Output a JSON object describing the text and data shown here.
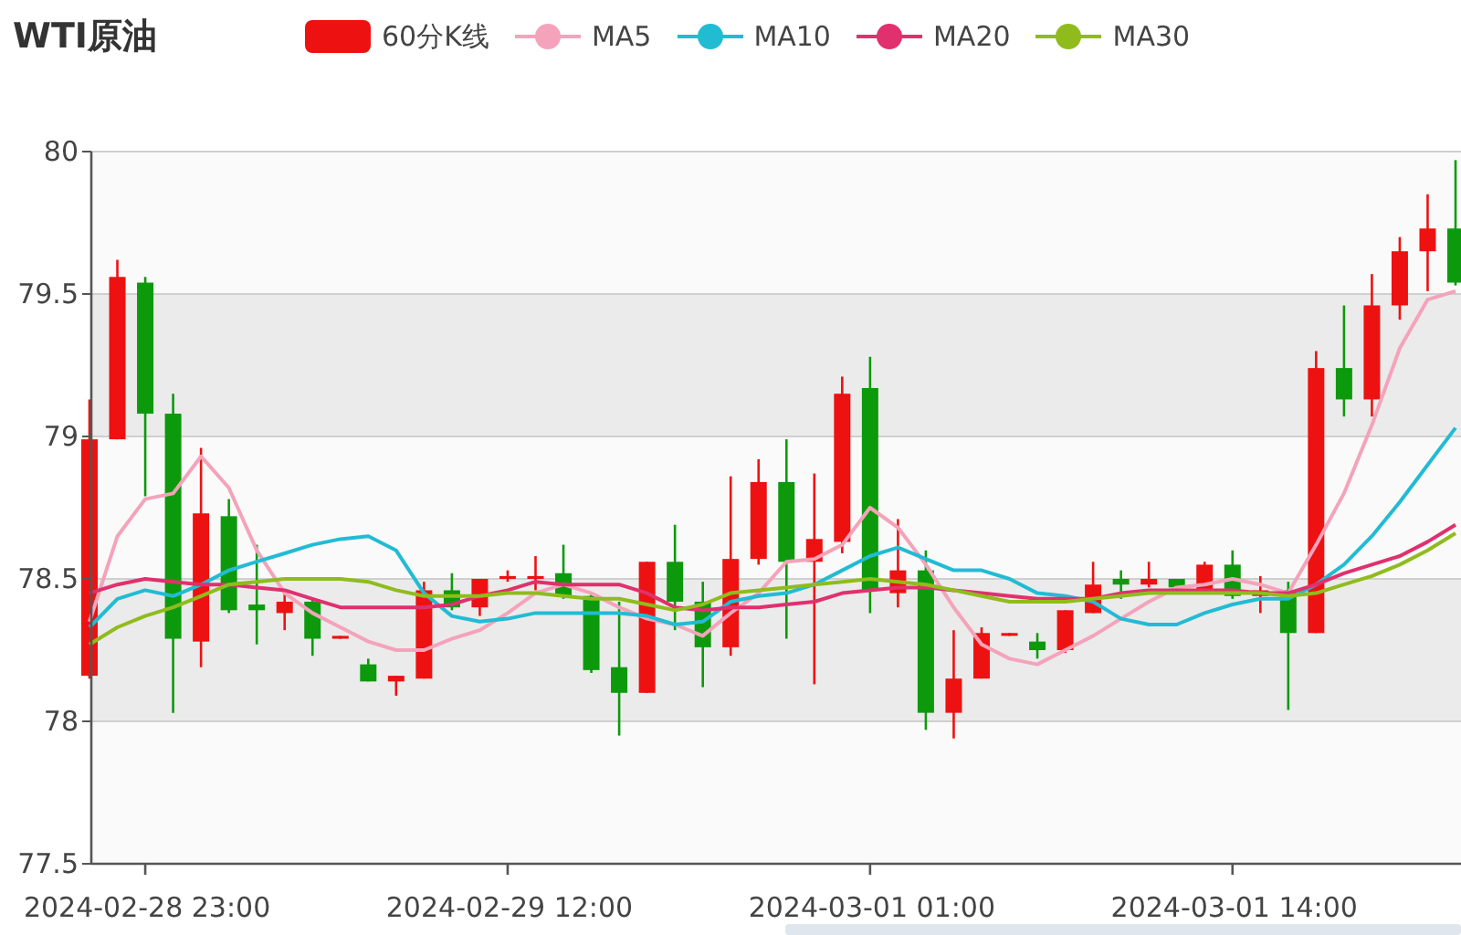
{
  "title": "WTI原油",
  "chart": {
    "candle_legend": {
      "label": "60分K线",
      "color": "#ee1111"
    },
    "chart_data": {
      "type": "candlestick",
      "grid": true,
      "ylim": [
        77.5,
        80
      ],
      "yticks": [
        {
          "value": 77.5,
          "label": "77.5"
        },
        {
          "value": 78,
          "label": "78"
        },
        {
          "value": 78.5,
          "label": "78.5"
        },
        {
          "value": 79,
          "label": "79"
        },
        {
          "value": 79.5,
          "label": "79.5"
        },
        {
          "value": 80,
          "label": "80"
        }
      ],
      "categories": [
        null,
        null,
        "2024-02-28 23:00",
        null,
        null,
        null,
        null,
        null,
        null,
        null,
        null,
        null,
        null,
        null,
        null,
        "2024-02-29 12:00",
        null,
        null,
        null,
        null,
        null,
        null,
        null,
        null,
        null,
        null,
        null,
        null,
        "2024-03-01 01:00",
        null,
        null,
        null,
        null,
        null,
        null,
        null,
        null,
        null,
        null,
        null,
        null,
        "2024-03-01 14:00",
        null,
        null,
        null,
        null,
        null,
        null,
        null,
        null
      ],
      "ohlc": [
        [
          78.16,
          79.13,
          78.15,
          78.99
        ],
        [
          78.99,
          79.62,
          78.99,
          79.56
        ],
        [
          79.54,
          79.56,
          78.79,
          79.08
        ],
        [
          79.08,
          79.15,
          78.03,
          78.29
        ],
        [
          78.28,
          78.96,
          78.19,
          78.73
        ],
        [
          78.72,
          78.78,
          78.38,
          78.39
        ],
        [
          78.41,
          78.62,
          78.27,
          78.39
        ],
        [
          78.38,
          78.46,
          78.32,
          78.42
        ],
        [
          78.42,
          78.43,
          78.23,
          78.29
        ],
        [
          78.29,
          78.3,
          78.29,
          78.3
        ],
        [
          78.2,
          78.22,
          78.14,
          78.14
        ],
        [
          78.14,
          78.16,
          78.09,
          78.16
        ],
        [
          78.15,
          78.49,
          78.15,
          78.46
        ],
        [
          78.46,
          78.52,
          78.39,
          78.4
        ],
        [
          78.4,
          78.5,
          78.37,
          78.5
        ],
        [
          78.5,
          78.53,
          78.49,
          78.51
        ],
        [
          78.5,
          78.58,
          78.46,
          78.51
        ],
        [
          78.52,
          78.62,
          78.43,
          78.44
        ],
        [
          78.44,
          78.45,
          78.17,
          78.18
        ],
        [
          78.19,
          78.42,
          77.95,
          78.1
        ],
        [
          78.1,
          78.56,
          78.1,
          78.56
        ],
        [
          78.56,
          78.69,
          78.32,
          78.42
        ],
        [
          78.42,
          78.49,
          78.12,
          78.26
        ],
        [
          78.26,
          78.86,
          78.23,
          78.57
        ],
        [
          78.57,
          78.92,
          78.55,
          78.84
        ],
        [
          78.84,
          78.99,
          78.29,
          78.56
        ],
        [
          78.56,
          78.87,
          78.13,
          78.64
        ],
        [
          78.63,
          79.21,
          78.59,
          79.15
        ],
        [
          79.17,
          79.28,
          78.38,
          78.46
        ],
        [
          78.45,
          78.71,
          78.4,
          78.53
        ],
        [
          78.53,
          78.6,
          77.97,
          78.03
        ],
        [
          78.03,
          78.32,
          77.94,
          78.15
        ],
        [
          78.15,
          78.33,
          78.15,
          78.31
        ],
        [
          78.3,
          78.31,
          78.3,
          78.31
        ],
        [
          78.28,
          78.31,
          78.22,
          78.25
        ],
        [
          78.25,
          78.39,
          78.24,
          78.39
        ],
        [
          78.38,
          78.56,
          78.38,
          78.48
        ],
        [
          78.5,
          78.53,
          78.43,
          78.48
        ],
        [
          78.48,
          78.56,
          78.47,
          78.5
        ],
        [
          78.5,
          78.5,
          78.47,
          78.47
        ],
        [
          78.46,
          78.56,
          78.46,
          78.55
        ],
        [
          78.55,
          78.6,
          78.43,
          78.44
        ],
        [
          78.44,
          78.51,
          78.38,
          78.46
        ],
        [
          78.46,
          78.49,
          78.04,
          78.31
        ],
        [
          78.31,
          79.3,
          78.31,
          79.24
        ],
        [
          79.24,
          79.46,
          79.07,
          79.13
        ],
        [
          79.13,
          79.57,
          79.07,
          79.46
        ],
        [
          79.46,
          79.7,
          79.41,
          79.65
        ],
        [
          79.65,
          79.85,
          79.51,
          79.73
        ],
        [
          79.73,
          79.97,
          79.53,
          79.54
        ]
      ],
      "series": [
        {
          "name": "MA5",
          "type": "line",
          "color": "#f4a3bb",
          "values": [
            78.35,
            78.65,
            78.78,
            78.8,
            78.93,
            78.82,
            78.6,
            78.45,
            78.38,
            78.33,
            78.28,
            78.25,
            78.25,
            78.29,
            78.32,
            78.38,
            78.45,
            78.48,
            78.45,
            78.4,
            78.36,
            78.34,
            78.3,
            78.38,
            78.45,
            78.56,
            78.57,
            78.62,
            78.75,
            78.68,
            78.55,
            78.4,
            78.27,
            78.22,
            78.2,
            78.25,
            78.3,
            78.36,
            78.42,
            78.47,
            78.48,
            78.5,
            78.48,
            78.45,
            78.62,
            78.8,
            79.04,
            79.31,
            79.48,
            79.51
          ]
        },
        {
          "name": "MA10",
          "type": "line",
          "color": "#22bbd4",
          "values": [
            78.33,
            78.43,
            78.46,
            78.44,
            78.48,
            78.53,
            78.56,
            78.59,
            78.62,
            78.64,
            78.65,
            78.6,
            78.45,
            78.37,
            78.35,
            78.36,
            78.38,
            78.38,
            78.38,
            78.38,
            78.37,
            78.34,
            78.35,
            78.42,
            78.44,
            78.45,
            78.48,
            78.53,
            78.58,
            78.61,
            78.57,
            78.53,
            78.53,
            78.5,
            78.45,
            78.44,
            78.42,
            78.36,
            78.34,
            78.34,
            78.38,
            78.41,
            78.43,
            78.43,
            78.48,
            78.55,
            78.65,
            78.77,
            78.9,
            79.03
          ]
        },
        {
          "name": "MA20",
          "type": "line",
          "color": "#e0306e",
          "values": [
            78.45,
            78.48,
            78.5,
            78.49,
            78.48,
            78.48,
            78.47,
            78.46,
            78.43,
            78.4,
            78.4,
            78.4,
            78.4,
            78.41,
            78.44,
            78.46,
            78.49,
            78.48,
            78.48,
            78.48,
            78.45,
            78.4,
            78.39,
            78.4,
            78.4,
            78.41,
            78.42,
            78.45,
            78.46,
            78.47,
            78.47,
            78.46,
            78.45,
            78.44,
            78.43,
            78.43,
            78.43,
            78.45,
            78.46,
            78.46,
            78.46,
            78.46,
            78.45,
            78.45,
            78.48,
            78.52,
            78.55,
            78.58,
            78.63,
            78.69
          ]
        },
        {
          "name": "MA30",
          "type": "line",
          "color": "#8fbc1c",
          "values": [
            78.27,
            78.33,
            78.37,
            78.4,
            78.44,
            78.48,
            78.49,
            78.5,
            78.5,
            78.5,
            78.49,
            78.46,
            78.44,
            78.44,
            78.44,
            78.45,
            78.45,
            78.44,
            78.43,
            78.43,
            78.41,
            78.39,
            78.41,
            78.45,
            78.46,
            78.47,
            78.48,
            78.49,
            78.5,
            78.49,
            78.48,
            78.46,
            78.44,
            78.42,
            78.42,
            78.42,
            78.43,
            78.44,
            78.45,
            78.45,
            78.45,
            78.45,
            78.45,
            78.44,
            78.45,
            78.48,
            78.51,
            78.55,
            78.6,
            78.66
          ]
        }
      ]
    }
  }
}
